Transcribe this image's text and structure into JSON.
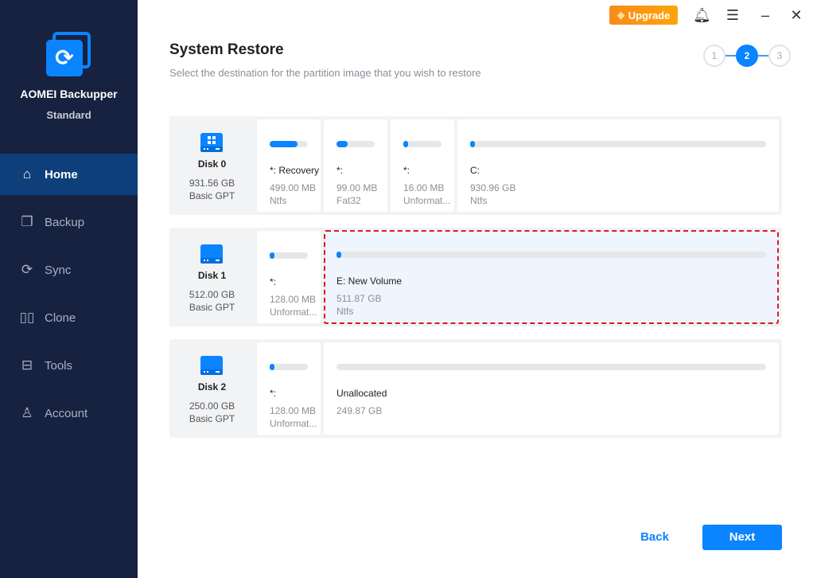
{
  "app": {
    "name": "AOMEI Backupper",
    "edition": "Standard"
  },
  "sidebar": {
    "items": [
      {
        "label": "Home",
        "icon": "home-icon",
        "active": true
      },
      {
        "label": "Backup",
        "icon": "backup-icon"
      },
      {
        "label": "Sync",
        "icon": "sync-icon"
      },
      {
        "label": "Clone",
        "icon": "clone-icon"
      },
      {
        "label": "Tools",
        "icon": "tools-icon"
      },
      {
        "label": "Account",
        "icon": "account-icon"
      }
    ]
  },
  "topbar": {
    "upgrade": "Upgrade"
  },
  "header": {
    "title": "System Restore",
    "subtitle": "Select the destination for the partition image that you wish to restore"
  },
  "steps": [
    "1",
    "2",
    "3"
  ],
  "current_step": 2,
  "disks": [
    {
      "name": "Disk 0",
      "size": "931.56 GB",
      "type": "Basic GPT",
      "partitions": [
        {
          "name": "*: Recovery",
          "size": "499.00 MB",
          "fs": "Ntfs",
          "used": 0.72
        },
        {
          "name": "*:",
          "size": "99.00 MB",
          "fs": "Fat32",
          "used": 0.3
        },
        {
          "name": "*:",
          "size": "16.00 MB",
          "fs": "Unformat...",
          "used": 0.05
        },
        {
          "name": "C:",
          "size": "930.96 GB",
          "fs": "Ntfs",
          "used": 0.01
        }
      ]
    },
    {
      "name": "Disk 1",
      "size": "512.00 GB",
      "type": "Basic GPT",
      "partitions": [
        {
          "name": "*:",
          "size": "128.00 MB",
          "fs": "Unformat...",
          "used": 0.05
        },
        {
          "name": "E: New Volume",
          "size": "511.87 GB",
          "fs": "Ntfs",
          "used": 0.01,
          "selected": true
        }
      ]
    },
    {
      "name": "Disk 2",
      "size": "250.00 GB",
      "type": "Basic GPT",
      "partitions": [
        {
          "name": "*:",
          "size": "128.00 MB",
          "fs": "Unformat...",
          "used": 0.05
        },
        {
          "name": "Unallocated",
          "size": "249.87 GB",
          "fs": "",
          "used": 0
        }
      ]
    }
  ],
  "footer": {
    "back": "Back",
    "next": "Next"
  },
  "colors": {
    "accent": "#0a84ff",
    "sidebar": "#16223f",
    "selected_border": "#e0161e"
  }
}
